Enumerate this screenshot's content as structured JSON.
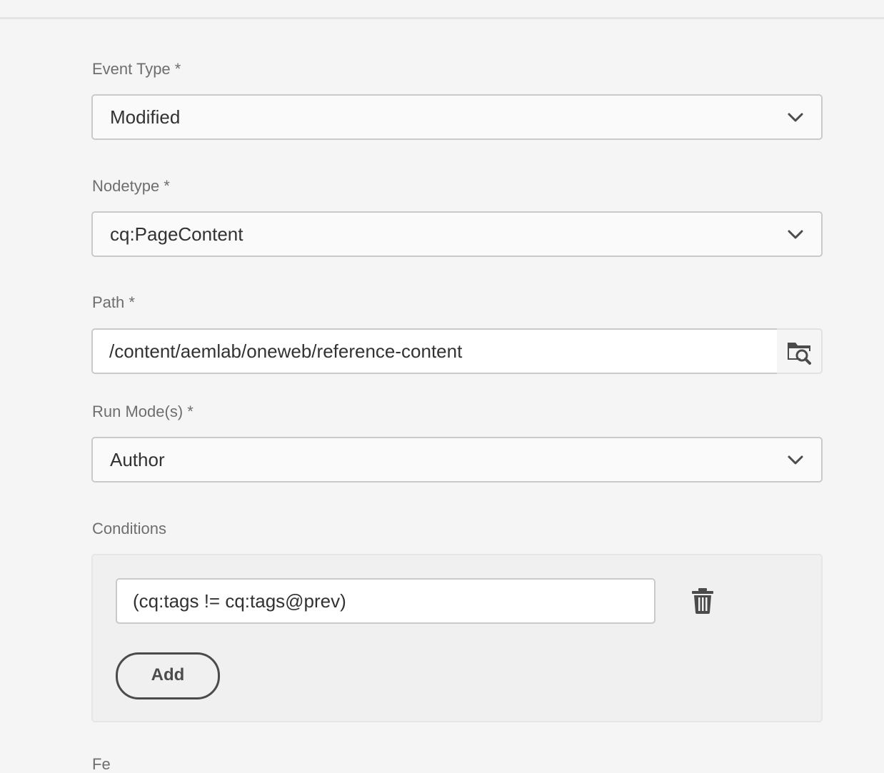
{
  "form": {
    "event_type": {
      "label": "Event Type *",
      "value": "Modified"
    },
    "nodetype": {
      "label": "Nodetype *",
      "value": "cq:PageContent"
    },
    "path": {
      "label": "Path *",
      "value": "/content/aemlab/oneweb/reference-content"
    },
    "run_modes": {
      "label": "Run Mode(s) *",
      "value": "Author"
    },
    "conditions": {
      "label": "Conditions",
      "items": [
        {
          "value": "(cq:tags != cq:tags@prev)"
        }
      ],
      "add_label": "Add"
    },
    "next_label_partial": "Fe"
  },
  "icons": {
    "dropdown": "chevron-down-icon",
    "browse": "folder-search-icon",
    "delete": "trash-icon"
  },
  "colors": {
    "background": "#f5f5f5",
    "field_border": "#cacaca",
    "text": "#323232",
    "label": "#6e6e6e"
  }
}
